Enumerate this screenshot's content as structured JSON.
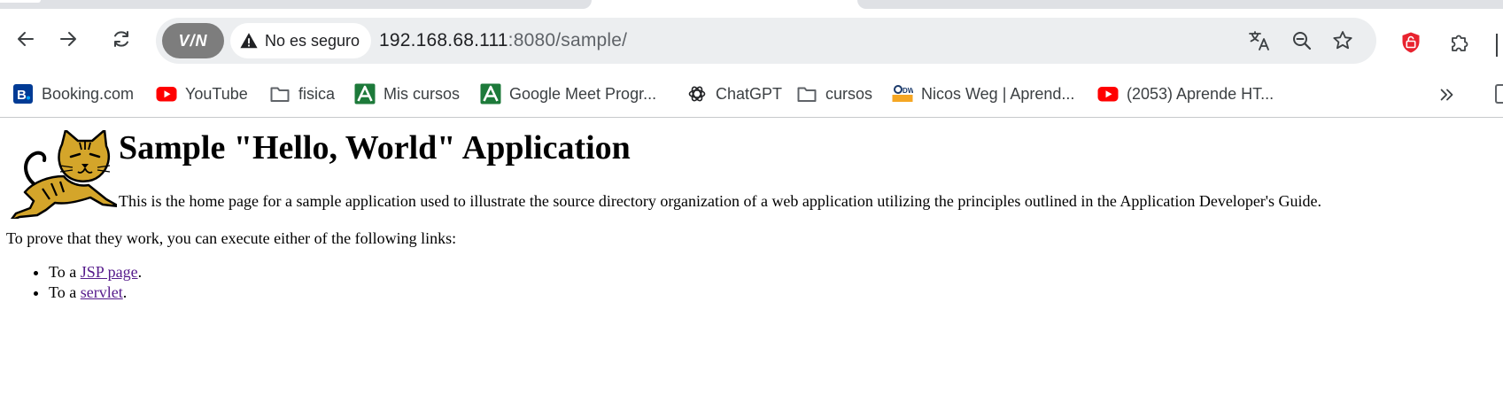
{
  "toolbar": {
    "back_icon": "arrow-left-icon",
    "forward_icon": "arrow-right-icon",
    "reload_icon": "reload-icon",
    "vpn_label": "V/N",
    "security_label": "No es seguro",
    "url_host": "192.168.68.111",
    "url_path": ":8080/sample/",
    "translate_icon": "translate-icon",
    "zoom_icon": "zoom-out-icon",
    "bookmark_icon": "star-icon",
    "extension_red_icon": "lock-shield-icon",
    "extensions_icon": "puzzle-piece-icon",
    "accent_color": "#e8232f"
  },
  "bookmarks": [
    {
      "label": "Booking.com",
      "icon": "booking-icon",
      "color": "#003b95"
    },
    {
      "label": "YouTube",
      "icon": "youtube-icon",
      "color": "#ff0000"
    },
    {
      "label": "fisica",
      "icon": "folder-icon",
      "color": "#5f6368"
    },
    {
      "label": "Mis cursos",
      "icon": "green-a-icon",
      "color": "#1d7a3a"
    },
    {
      "label": "Google Meet Progr...",
      "icon": "green-a-icon",
      "color": "#1d7a3a"
    },
    {
      "label": "ChatGPT",
      "icon": "chatgpt-icon",
      "color": "#202124"
    },
    {
      "label": "cursos",
      "icon": "folder-icon",
      "color": "#5f6368"
    },
    {
      "label": "Nicos Weg | Aprend...",
      "icon": "dw-icon",
      "color": "#f5a623"
    },
    {
      "label": "(2053) Aprende HT...",
      "icon": "youtube-icon",
      "color": "#ff0000"
    }
  ],
  "bookmarks_more_icon": "double-chevron-right-icon",
  "page": {
    "title": "Sample \"Hello, World\" Application",
    "intro": "This is the home page for a sample application used to illustrate the source directory organization of a web application utilizing the principles outlined in the Application Developer's Guide.",
    "prove": "To prove that they work, you can execute either of the following links:",
    "links": [
      {
        "prefix": "To a ",
        "link_text": "JSP page",
        "suffix": "."
      },
      {
        "prefix": "To a ",
        "link_text": "servlet",
        "suffix": "."
      }
    ],
    "link_color": "#551a8b",
    "logo_icon": "tomcat-logo-icon"
  }
}
